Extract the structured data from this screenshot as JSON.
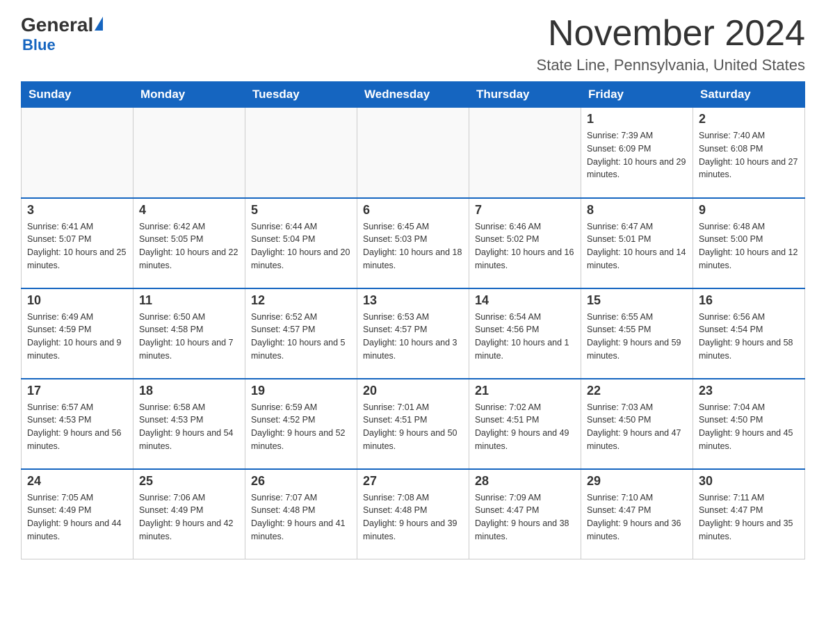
{
  "header": {
    "logo": {
      "general": "General",
      "blue": "Blue"
    },
    "title": "November 2024",
    "location": "State Line, Pennsylvania, United States"
  },
  "calendar": {
    "days_of_week": [
      "Sunday",
      "Monday",
      "Tuesday",
      "Wednesday",
      "Thursday",
      "Friday",
      "Saturday"
    ],
    "weeks": [
      [
        {
          "day": "",
          "info": ""
        },
        {
          "day": "",
          "info": ""
        },
        {
          "day": "",
          "info": ""
        },
        {
          "day": "",
          "info": ""
        },
        {
          "day": "",
          "info": ""
        },
        {
          "day": "1",
          "info": "Sunrise: 7:39 AM\nSunset: 6:09 PM\nDaylight: 10 hours and 29 minutes."
        },
        {
          "day": "2",
          "info": "Sunrise: 7:40 AM\nSunset: 6:08 PM\nDaylight: 10 hours and 27 minutes."
        }
      ],
      [
        {
          "day": "3",
          "info": "Sunrise: 6:41 AM\nSunset: 5:07 PM\nDaylight: 10 hours and 25 minutes."
        },
        {
          "day": "4",
          "info": "Sunrise: 6:42 AM\nSunset: 5:05 PM\nDaylight: 10 hours and 22 minutes."
        },
        {
          "day": "5",
          "info": "Sunrise: 6:44 AM\nSunset: 5:04 PM\nDaylight: 10 hours and 20 minutes."
        },
        {
          "day": "6",
          "info": "Sunrise: 6:45 AM\nSunset: 5:03 PM\nDaylight: 10 hours and 18 minutes."
        },
        {
          "day": "7",
          "info": "Sunrise: 6:46 AM\nSunset: 5:02 PM\nDaylight: 10 hours and 16 minutes."
        },
        {
          "day": "8",
          "info": "Sunrise: 6:47 AM\nSunset: 5:01 PM\nDaylight: 10 hours and 14 minutes."
        },
        {
          "day": "9",
          "info": "Sunrise: 6:48 AM\nSunset: 5:00 PM\nDaylight: 10 hours and 12 minutes."
        }
      ],
      [
        {
          "day": "10",
          "info": "Sunrise: 6:49 AM\nSunset: 4:59 PM\nDaylight: 10 hours and 9 minutes."
        },
        {
          "day": "11",
          "info": "Sunrise: 6:50 AM\nSunset: 4:58 PM\nDaylight: 10 hours and 7 minutes."
        },
        {
          "day": "12",
          "info": "Sunrise: 6:52 AM\nSunset: 4:57 PM\nDaylight: 10 hours and 5 minutes."
        },
        {
          "day": "13",
          "info": "Sunrise: 6:53 AM\nSunset: 4:57 PM\nDaylight: 10 hours and 3 minutes."
        },
        {
          "day": "14",
          "info": "Sunrise: 6:54 AM\nSunset: 4:56 PM\nDaylight: 10 hours and 1 minute."
        },
        {
          "day": "15",
          "info": "Sunrise: 6:55 AM\nSunset: 4:55 PM\nDaylight: 9 hours and 59 minutes."
        },
        {
          "day": "16",
          "info": "Sunrise: 6:56 AM\nSunset: 4:54 PM\nDaylight: 9 hours and 58 minutes."
        }
      ],
      [
        {
          "day": "17",
          "info": "Sunrise: 6:57 AM\nSunset: 4:53 PM\nDaylight: 9 hours and 56 minutes."
        },
        {
          "day": "18",
          "info": "Sunrise: 6:58 AM\nSunset: 4:53 PM\nDaylight: 9 hours and 54 minutes."
        },
        {
          "day": "19",
          "info": "Sunrise: 6:59 AM\nSunset: 4:52 PM\nDaylight: 9 hours and 52 minutes."
        },
        {
          "day": "20",
          "info": "Sunrise: 7:01 AM\nSunset: 4:51 PM\nDaylight: 9 hours and 50 minutes."
        },
        {
          "day": "21",
          "info": "Sunrise: 7:02 AM\nSunset: 4:51 PM\nDaylight: 9 hours and 49 minutes."
        },
        {
          "day": "22",
          "info": "Sunrise: 7:03 AM\nSunset: 4:50 PM\nDaylight: 9 hours and 47 minutes."
        },
        {
          "day": "23",
          "info": "Sunrise: 7:04 AM\nSunset: 4:50 PM\nDaylight: 9 hours and 45 minutes."
        }
      ],
      [
        {
          "day": "24",
          "info": "Sunrise: 7:05 AM\nSunset: 4:49 PM\nDaylight: 9 hours and 44 minutes."
        },
        {
          "day": "25",
          "info": "Sunrise: 7:06 AM\nSunset: 4:49 PM\nDaylight: 9 hours and 42 minutes."
        },
        {
          "day": "26",
          "info": "Sunrise: 7:07 AM\nSunset: 4:48 PM\nDaylight: 9 hours and 41 minutes."
        },
        {
          "day": "27",
          "info": "Sunrise: 7:08 AM\nSunset: 4:48 PM\nDaylight: 9 hours and 39 minutes."
        },
        {
          "day": "28",
          "info": "Sunrise: 7:09 AM\nSunset: 4:47 PM\nDaylight: 9 hours and 38 minutes."
        },
        {
          "day": "29",
          "info": "Sunrise: 7:10 AM\nSunset: 4:47 PM\nDaylight: 9 hours and 36 minutes."
        },
        {
          "day": "30",
          "info": "Sunrise: 7:11 AM\nSunset: 4:47 PM\nDaylight: 9 hours and 35 minutes."
        }
      ]
    ]
  }
}
